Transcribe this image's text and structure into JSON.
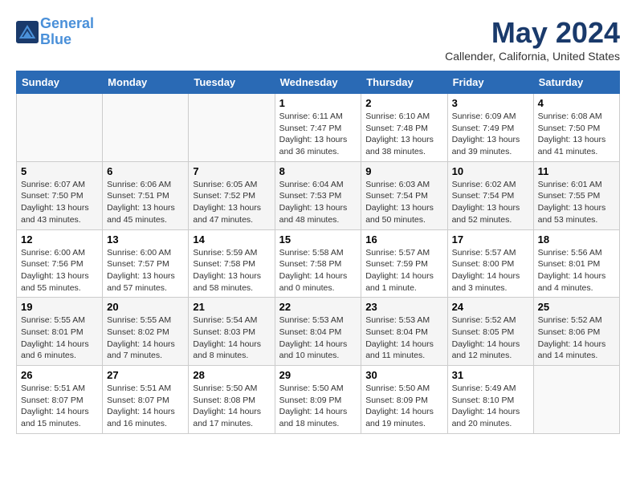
{
  "header": {
    "logo_line1": "General",
    "logo_line2": "Blue",
    "month_year": "May 2024",
    "location": "Callender, California, United States"
  },
  "days_of_week": [
    "Sunday",
    "Monday",
    "Tuesday",
    "Wednesday",
    "Thursday",
    "Friday",
    "Saturday"
  ],
  "weeks": [
    [
      {
        "day": "",
        "info": ""
      },
      {
        "day": "",
        "info": ""
      },
      {
        "day": "",
        "info": ""
      },
      {
        "day": "1",
        "info": "Sunrise: 6:11 AM\nSunset: 7:47 PM\nDaylight: 13 hours and 36 minutes."
      },
      {
        "day": "2",
        "info": "Sunrise: 6:10 AM\nSunset: 7:48 PM\nDaylight: 13 hours and 38 minutes."
      },
      {
        "day": "3",
        "info": "Sunrise: 6:09 AM\nSunset: 7:49 PM\nDaylight: 13 hours and 39 minutes."
      },
      {
        "day": "4",
        "info": "Sunrise: 6:08 AM\nSunset: 7:50 PM\nDaylight: 13 hours and 41 minutes."
      }
    ],
    [
      {
        "day": "5",
        "info": "Sunrise: 6:07 AM\nSunset: 7:50 PM\nDaylight: 13 hours and 43 minutes."
      },
      {
        "day": "6",
        "info": "Sunrise: 6:06 AM\nSunset: 7:51 PM\nDaylight: 13 hours and 45 minutes."
      },
      {
        "day": "7",
        "info": "Sunrise: 6:05 AM\nSunset: 7:52 PM\nDaylight: 13 hours and 47 minutes."
      },
      {
        "day": "8",
        "info": "Sunrise: 6:04 AM\nSunset: 7:53 PM\nDaylight: 13 hours and 48 minutes."
      },
      {
        "day": "9",
        "info": "Sunrise: 6:03 AM\nSunset: 7:54 PM\nDaylight: 13 hours and 50 minutes."
      },
      {
        "day": "10",
        "info": "Sunrise: 6:02 AM\nSunset: 7:54 PM\nDaylight: 13 hours and 52 minutes."
      },
      {
        "day": "11",
        "info": "Sunrise: 6:01 AM\nSunset: 7:55 PM\nDaylight: 13 hours and 53 minutes."
      }
    ],
    [
      {
        "day": "12",
        "info": "Sunrise: 6:00 AM\nSunset: 7:56 PM\nDaylight: 13 hours and 55 minutes."
      },
      {
        "day": "13",
        "info": "Sunrise: 6:00 AM\nSunset: 7:57 PM\nDaylight: 13 hours and 57 minutes."
      },
      {
        "day": "14",
        "info": "Sunrise: 5:59 AM\nSunset: 7:58 PM\nDaylight: 13 hours and 58 minutes."
      },
      {
        "day": "15",
        "info": "Sunrise: 5:58 AM\nSunset: 7:58 PM\nDaylight: 14 hours and 0 minutes."
      },
      {
        "day": "16",
        "info": "Sunrise: 5:57 AM\nSunset: 7:59 PM\nDaylight: 14 hours and 1 minute."
      },
      {
        "day": "17",
        "info": "Sunrise: 5:57 AM\nSunset: 8:00 PM\nDaylight: 14 hours and 3 minutes."
      },
      {
        "day": "18",
        "info": "Sunrise: 5:56 AM\nSunset: 8:01 PM\nDaylight: 14 hours and 4 minutes."
      }
    ],
    [
      {
        "day": "19",
        "info": "Sunrise: 5:55 AM\nSunset: 8:01 PM\nDaylight: 14 hours and 6 minutes."
      },
      {
        "day": "20",
        "info": "Sunrise: 5:55 AM\nSunset: 8:02 PM\nDaylight: 14 hours and 7 minutes."
      },
      {
        "day": "21",
        "info": "Sunrise: 5:54 AM\nSunset: 8:03 PM\nDaylight: 14 hours and 8 minutes."
      },
      {
        "day": "22",
        "info": "Sunrise: 5:53 AM\nSunset: 8:04 PM\nDaylight: 14 hours and 10 minutes."
      },
      {
        "day": "23",
        "info": "Sunrise: 5:53 AM\nSunset: 8:04 PM\nDaylight: 14 hours and 11 minutes."
      },
      {
        "day": "24",
        "info": "Sunrise: 5:52 AM\nSunset: 8:05 PM\nDaylight: 14 hours and 12 minutes."
      },
      {
        "day": "25",
        "info": "Sunrise: 5:52 AM\nSunset: 8:06 PM\nDaylight: 14 hours and 14 minutes."
      }
    ],
    [
      {
        "day": "26",
        "info": "Sunrise: 5:51 AM\nSunset: 8:07 PM\nDaylight: 14 hours and 15 minutes."
      },
      {
        "day": "27",
        "info": "Sunrise: 5:51 AM\nSunset: 8:07 PM\nDaylight: 14 hours and 16 minutes."
      },
      {
        "day": "28",
        "info": "Sunrise: 5:50 AM\nSunset: 8:08 PM\nDaylight: 14 hours and 17 minutes."
      },
      {
        "day": "29",
        "info": "Sunrise: 5:50 AM\nSunset: 8:09 PM\nDaylight: 14 hours and 18 minutes."
      },
      {
        "day": "30",
        "info": "Sunrise: 5:50 AM\nSunset: 8:09 PM\nDaylight: 14 hours and 19 minutes."
      },
      {
        "day": "31",
        "info": "Sunrise: 5:49 AM\nSunset: 8:10 PM\nDaylight: 14 hours and 20 minutes."
      },
      {
        "day": "",
        "info": ""
      }
    ]
  ]
}
